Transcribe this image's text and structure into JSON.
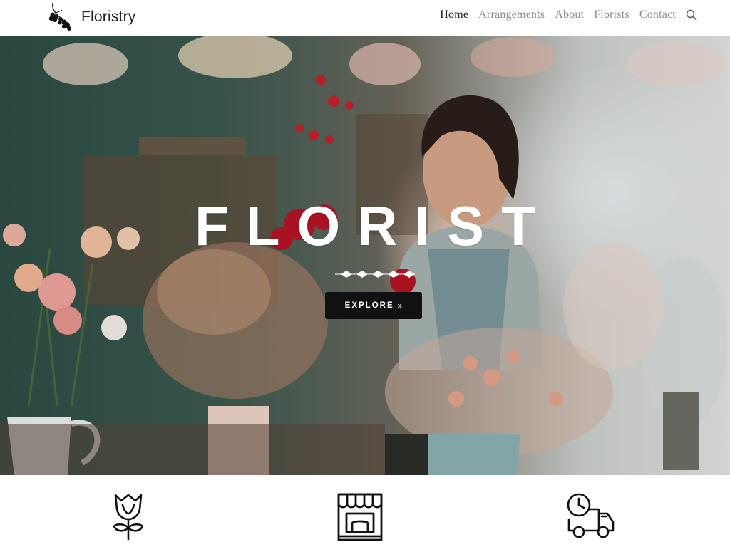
{
  "brand": {
    "name": "Floristry",
    "logo_icon": "orchid-branch-icon"
  },
  "nav": {
    "items": [
      {
        "label": "Home",
        "active": true
      },
      {
        "label": "Arrangements",
        "active": false
      },
      {
        "label": "About",
        "active": false
      },
      {
        "label": "Florists",
        "active": false
      },
      {
        "label": "Contact",
        "active": false
      }
    ],
    "search_icon": "search-icon"
  },
  "hero": {
    "title": "FLORIST",
    "button_label": "EXPLORE",
    "button_arrows": "»",
    "divider_icon": "diamond-divider-icon"
  },
  "features": [
    {
      "icon": "tulip-bouquet-icon"
    },
    {
      "icon": "storefront-icon"
    },
    {
      "icon": "delivery-truck-clock-icon"
    }
  ],
  "colors": {
    "nav_active": "#222222",
    "nav_inactive": "#8a8a8a",
    "button_bg": "#111111",
    "hero_text": "#ffffff"
  }
}
